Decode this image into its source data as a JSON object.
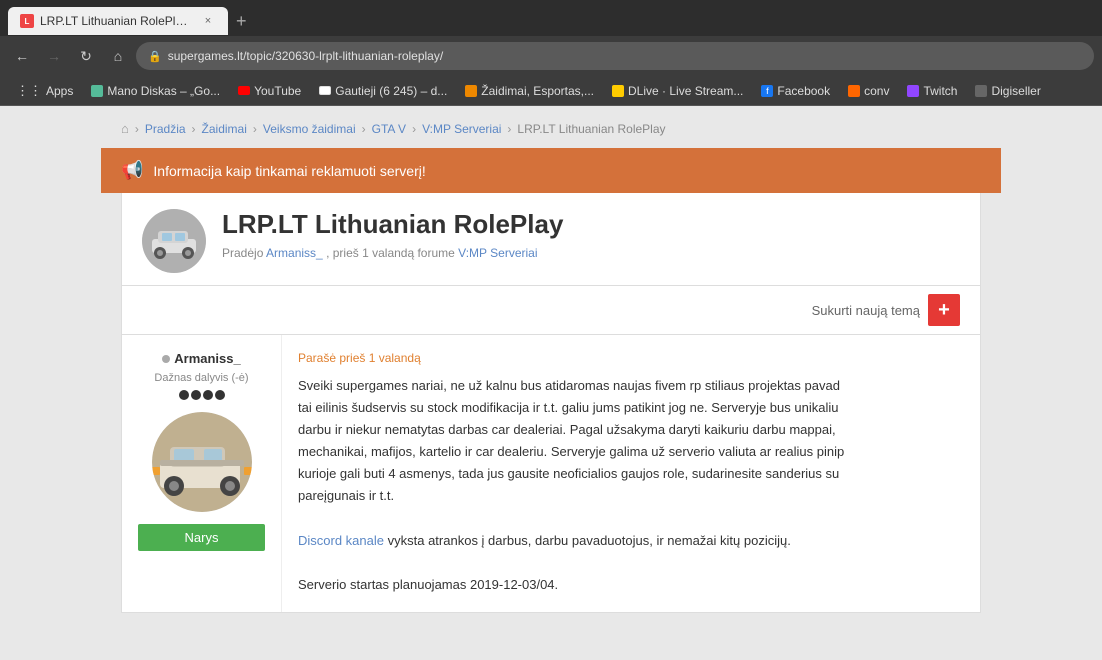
{
  "browser": {
    "tab_title": "LRP.LT Lithuanian RolePlay - V:M",
    "url": "supergames.lt/topic/320630-lrplt-lithuanian-roleplay/",
    "new_tab_label": "+",
    "close_label": "×"
  },
  "nav_buttons": {
    "back": "←",
    "forward": "→",
    "reload": "↻",
    "home": "⌂"
  },
  "bookmarks": [
    {
      "id": "apps",
      "label": "Apps",
      "type": "apps"
    },
    {
      "id": "mano-diskas",
      "label": "Mano Diskas – „Go...",
      "type": "disk"
    },
    {
      "id": "youtube",
      "label": "YouTube",
      "type": "yt"
    },
    {
      "id": "gautieji",
      "label": "Gautieji (6 245) – d...",
      "type": "gmail"
    },
    {
      "id": "zaidimai",
      "label": "Žaidimai, Esportas,...",
      "type": "games"
    },
    {
      "id": "dlive",
      "label": "DLive · Live Stream...",
      "type": "dlive"
    },
    {
      "id": "facebook",
      "label": "Facebook",
      "type": "fb"
    },
    {
      "id": "conv",
      "label": "conv",
      "type": "r"
    },
    {
      "id": "twitch",
      "label": "Twitch",
      "type": "twitch"
    },
    {
      "id": "digiseller",
      "label": "Digiseller",
      "type": "digi"
    }
  ],
  "breadcrumb": {
    "home_icon": "⌂",
    "items": [
      "Pradžia",
      "Žaidimai",
      "Veiksmo žaidimai",
      "GTA V",
      "V:MP Serveriai",
      "LRP.LT Lithuanian RolePlay"
    ]
  },
  "banner": {
    "icon": "📢",
    "text": "Informacija kaip tinkamai reklamuoti serverį!"
  },
  "topic": {
    "title": "LRP.LT Lithuanian RolePlay",
    "meta": "Pradėjo Armaniss_, prieš 1 valandą forume V:MP Serveriai",
    "sukurti_label": "Sukurti naują temą"
  },
  "post": {
    "time_label": "Parašė prieš 1 valandą",
    "user": {
      "name": "Armaniss_",
      "rank": "Dažnas dalyvis (-ė)",
      "stars": 4,
      "narys_label": "Narys"
    },
    "content_line1": "Sveiki supergames nariai, ne už kalnu bus atidaromas naujas fivem rp stiliaus projektas pavad",
    "content_line2": "tai eilinis šudservis su stock modifikacija ir t.t. galiu jums patikint jog ne. Serveryje bus unikaliu",
    "content_line3": "darbu ir niekur nematytas darbas car dealeriai. Pagal užsakyma daryti kaikuriu darbu mappai,",
    "content_line4": "mechanikai, mafijos, kartelio ir car dealeriu. Serveryje galima už serverio valiuta ar realius pinip",
    "content_line5": "kurioje gali buti 4 asmenys, tada jus gausite neoficialios gaujos role, sudarinesite sanderius su",
    "content_line6": "pareįgunais ir t.t.",
    "content_line7": "",
    "discord_line": "Discord kanale vyksta atrankos į darbus, darbu pavaduotojus, ir nemažai kitų pozicijų.",
    "serverio_line": "Serverio startas planuojamas 2019-12-03/04.",
    "discord_link": "Discord kanale"
  },
  "cursor": {
    "symbol": "↖"
  }
}
